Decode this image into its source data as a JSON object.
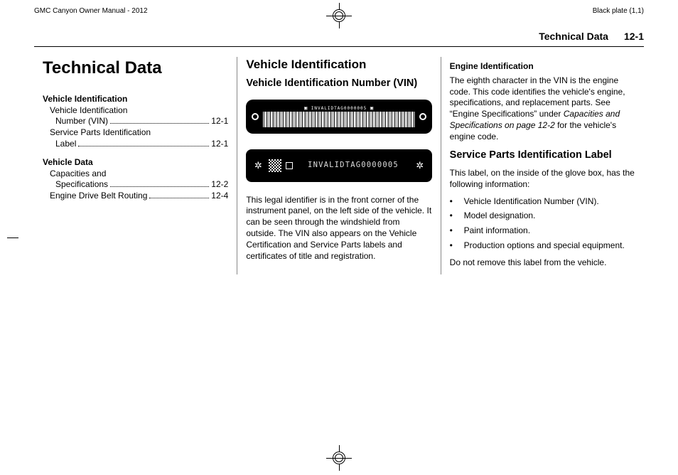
{
  "top_header": {
    "left": "GMC Canyon Owner Manual - 2012",
    "right": "Black plate (1,1)"
  },
  "running_header": {
    "title": "Technical Data",
    "pageno": "12-1"
  },
  "col1": {
    "chapter": "Technical Data",
    "toc": {
      "group1": {
        "head": "Vehicle Identification",
        "item1_l1": "Vehicle Identification",
        "item1_l2": "Number (VIN)",
        "item1_page": "12-1",
        "item2_l1": "Service Parts Identification",
        "item2_l2": "Label",
        "item2_page": "12-1"
      },
      "group2": {
        "head": "Vehicle Data",
        "item1_l1": "Capacities and",
        "item1_l2": "Specifications",
        "item1_page": "12-2",
        "item2": "Engine Drive Belt Routing",
        "item2_page": "12-4"
      }
    }
  },
  "col2": {
    "section": "Vehicle Identification",
    "subsection": "Vehicle Identification Number (VIN)",
    "vin_top_text": "INVALIDTAG0000005",
    "vin_plate2_text": "INVALIDTAG0000005",
    "p1": "This legal identifier is in the front corner of the instrument panel, on the left side of the vehicle. It can be seen through the windshield from outside. The VIN also appears on the Vehicle Certification and Service Parts labels and certificates of title and registration."
  },
  "col3": {
    "h4": "Engine Identification",
    "p1a": "The eighth character in the VIN is the engine code. This code identifies the vehicle's engine, specifications, and replacement parts. See “Engine Specifications” under ",
    "p1b": "Capacities and Specifications on page 12-2",
    "p1c": " for the vehicle's engine code.",
    "h3": "Service Parts Identification Label",
    "p2": "This label, on the inside of the glove box, has the following information:",
    "list": {
      "i1": "Vehicle Identification Number (VIN).",
      "i2": "Model designation.",
      "i3": "Paint information.",
      "i4": "Production options and special equipment."
    },
    "p3": "Do not remove this label from the vehicle."
  },
  "bullet": "•"
}
